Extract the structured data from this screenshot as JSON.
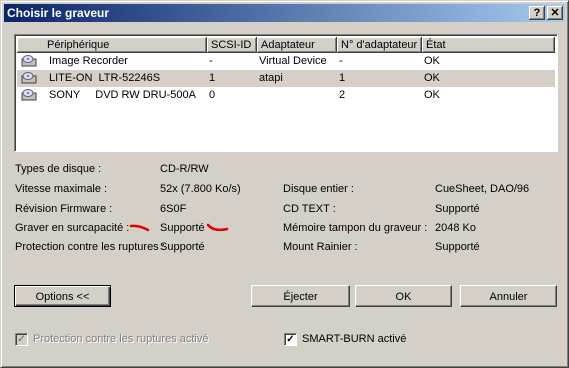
{
  "window": {
    "title": "Choisir le graveur",
    "help_btn": "?",
    "close_btn": "✕"
  },
  "devices": {
    "columns": [
      "Périphérique",
      "SCSI-ID",
      "Adaptateur",
      "N° d'adaptateur",
      "État"
    ],
    "rows": [
      {
        "name": "Image Recorder",
        "scsi": "-",
        "adapter": "Virtual Device",
        "num": "-",
        "state": "OK",
        "selected": false
      },
      {
        "name": "LITE-ON  LTR-52246S",
        "scsi": "1",
        "adapter": "atapi",
        "num": "1",
        "state": "OK",
        "selected": true
      },
      {
        "name": "SONY     DVD RW DRU-500A",
        "scsi": "0",
        "adapter": "",
        "num": "2",
        "state": "OK",
        "selected": false
      }
    ]
  },
  "info": {
    "disc_types_label": "Types de disque :",
    "disc_types_value": "CD-R/RW",
    "max_speed_label": "Vitesse maximale :",
    "max_speed_value": "52x (7.800 Ko/s)",
    "firmware_label": "Révision Firmware :",
    "firmware_value": "6S0F",
    "overburn_label": "Graver en surcapacité :",
    "overburn_value": "Supporté",
    "underrun_label": "Protection contre les ruptures :",
    "underrun_value": "Supporté",
    "whole_disc_label": "Disque entier :",
    "whole_disc_value": "CueSheet, DAO/96",
    "cdtext_label": "CD TEXT :",
    "cdtext_value": "Supporté",
    "buffer_label": "Mémoire tampon du graveur :",
    "buffer_value": "2048 Ko",
    "mount_rainier_label": "Mount Rainier :",
    "mount_rainier_value": "Supporté"
  },
  "buttons": {
    "options": "Options <<",
    "eject": "Éjecter",
    "ok": "OK",
    "cancel": "Annuler"
  },
  "checkboxes": {
    "protection_label": "Protection contre les ruptures activé",
    "protection_checked": true,
    "protection_enabled": false,
    "smartburn_label": "SMART-BURN activé",
    "smartburn_checked": true
  },
  "colors": {
    "title_start": "#0a246a",
    "title_end": "#a6caf0",
    "face": "#d4d0c8",
    "annotation_red": "#e00000"
  }
}
